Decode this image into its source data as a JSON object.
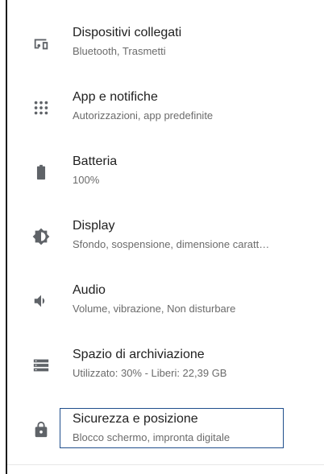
{
  "items": [
    {
      "title": "Dispositivi collegati",
      "subtitle": "Bluetooth, Trasmetti",
      "icon": "connected-devices-icon"
    },
    {
      "title": "App e notifiche",
      "subtitle": "Autorizzazioni, app predefinite",
      "icon": "apps-grid-icon"
    },
    {
      "title": "Batteria",
      "subtitle": "100%",
      "icon": "battery-icon"
    },
    {
      "title": "Display",
      "subtitle": "Sfondo, sospensione, dimensione caratt…",
      "icon": "brightness-icon"
    },
    {
      "title": "Audio",
      "subtitle": "Volume, vibrazione, Non disturbare",
      "icon": "volume-icon"
    },
    {
      "title": "Spazio di archiviazione",
      "subtitle": "Utilizzato: 30% - Liberi: 22,39 GB",
      "icon": "storage-icon"
    },
    {
      "title": "Sicurezza e posizione",
      "subtitle": "Blocco schermo, impronta digitale",
      "icon": "lock-icon"
    }
  ],
  "colors": {
    "icon": "#5f6368",
    "focus": "#1f4e8c"
  }
}
